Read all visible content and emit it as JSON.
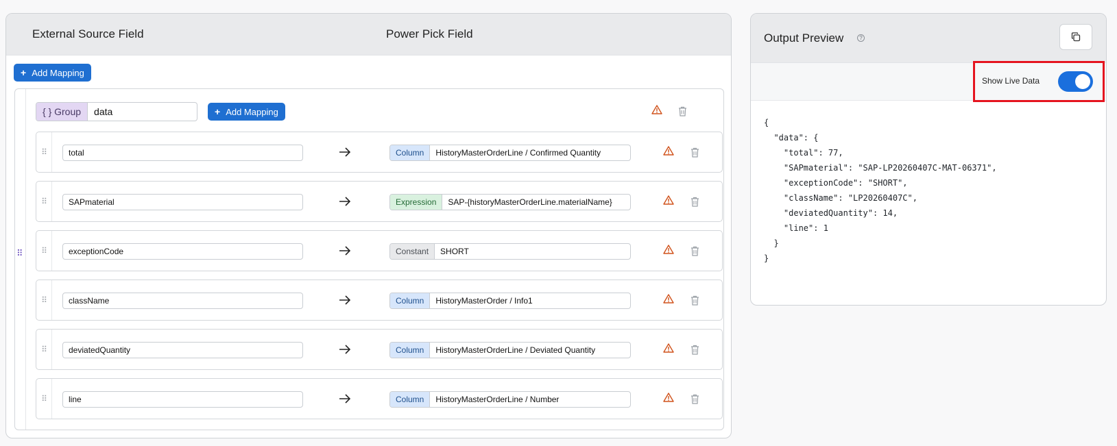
{
  "mapper": {
    "header_left": "External Source Field",
    "header_right": "Power Pick Field",
    "add_mapping_label": "Add Mapping",
    "group": {
      "badge": "{ } Group",
      "name": "data",
      "add_mapping_label": "Add Mapping"
    },
    "rows": [
      {
        "source": "total",
        "kind": "Column",
        "target": "HistoryMasterOrderLine / Confirmed Quantity"
      },
      {
        "source": "SAPmaterial",
        "kind": "Expression",
        "target": "SAP-{historyMasterOrderLine.materialName}"
      },
      {
        "source": "exceptionCode",
        "kind": "Constant",
        "target": "SHORT"
      },
      {
        "source": "className",
        "kind": "Column",
        "target": "HistoryMasterOrder / Info1"
      },
      {
        "source": "deviatedQuantity",
        "kind": "Column",
        "target": "HistoryMasterOrderLine / Deviated Quantity"
      },
      {
        "source": "line",
        "kind": "Column",
        "target": "HistoryMasterOrderLine / Number"
      }
    ]
  },
  "preview": {
    "title": "Output Preview",
    "help_glyph": "?",
    "live_label": "Show Live Data",
    "live_enabled": true,
    "json_lines": [
      "{",
      "  \"data\": {",
      "    \"total\": 77,",
      "    \"SAPmaterial\": \"SAP-LP20260407C-MAT-06371\",",
      "    \"exceptionCode\": \"SHORT\",",
      "    \"className\": \"LP20260407C\",",
      "    \"deviatedQuantity\": 14,",
      "    \"line\": 1",
      "  }",
      "}"
    ]
  },
  "colors": {
    "accent": "#1f6fd1",
    "warning": "#d0521b",
    "highlight": "#e5141f",
    "group_badge": "#e3d7f3",
    "column_badge": "#d7e6fb",
    "expression_badge": "#d9f1df",
    "constant_badge": "#e8e9eb"
  }
}
